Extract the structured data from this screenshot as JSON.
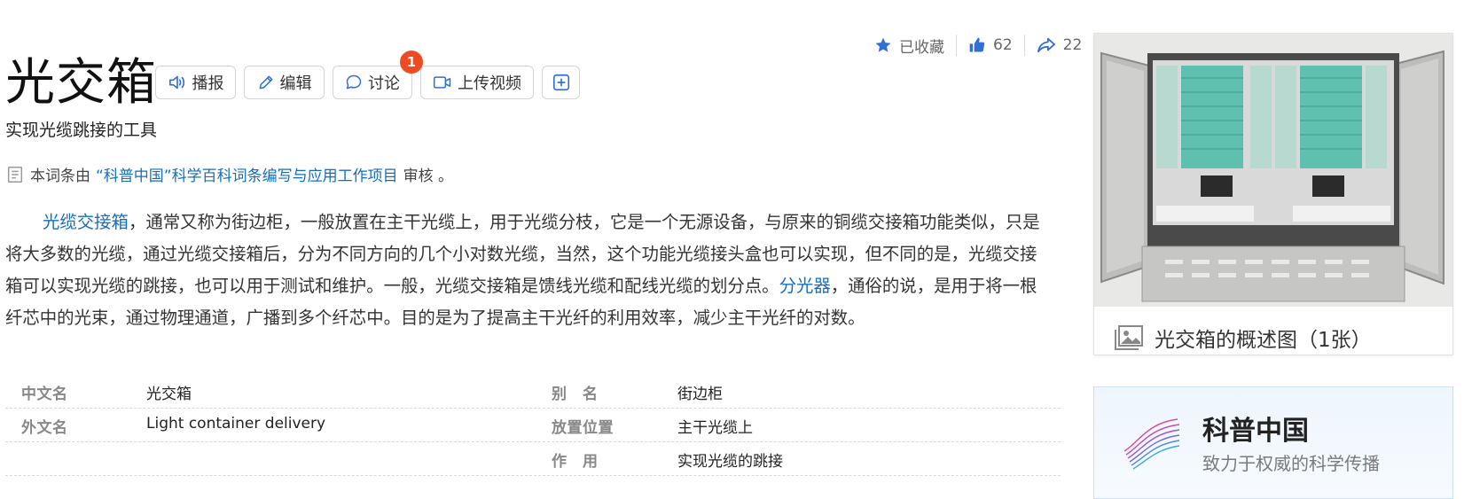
{
  "stats": {
    "favorite_label": "已收藏",
    "likes": "62",
    "shares": "22"
  },
  "title": "光交箱",
  "toolbar": {
    "broadcast": "播报",
    "edit": "编辑",
    "discuss": "讨论",
    "discuss_badge": "1",
    "upload_video": "上传视频"
  },
  "subtitle": "实现光缆跳接的工具",
  "review": {
    "prefix": "本词条由",
    "link": "“科普中国”科学百科词条编写与应用工作项目",
    "suffix": " 审核 。"
  },
  "summary": {
    "link1": "光缆交接箱",
    "text1": "，通常又称为街边柜，一般放置在主干光缆上，用于光缆分枝，它是一个无源设备，与原来的铜缆交接箱功能类似，只是将大多数的光缆，通过光缆交接箱后，分为不同方向的几个小对数光缆，当然，这个功能光缆接头盒也可以实现，但不同的是，光缆交接箱可以实现光缆的跳接，也可以用于测试和维护。一般，光缆交接箱是馈线光缆和配线光缆的划分点。",
    "link2": "分光器",
    "text2": "，通俗的说，是用于将一根纤芯中的光束，通过物理通道，广播到多个纤芯中。目的是为了提高主干光纤的利用效率，减少主干光纤的对数。"
  },
  "basic_info": [
    {
      "k1": "中文名",
      "v1": "光交箱",
      "k2": "别　名",
      "v2": "街边柜"
    },
    {
      "k1": "外文名",
      "v1": "Light container delivery",
      "k2": "放置位置",
      "v2": "主干光缆上"
    },
    {
      "k1": "",
      "v1": "",
      "k2": "作　用",
      "v2": "实现光缆的跳接"
    }
  ],
  "image_card": {
    "caption": "光交箱的概述图（1张）"
  },
  "kepu": {
    "name": "科普中国",
    "slogan": "致力于权威的科学传播"
  },
  "colors": {
    "link": "#136ec2",
    "badge": "#ee4a23",
    "icon_blue": "#2f6fd6"
  }
}
